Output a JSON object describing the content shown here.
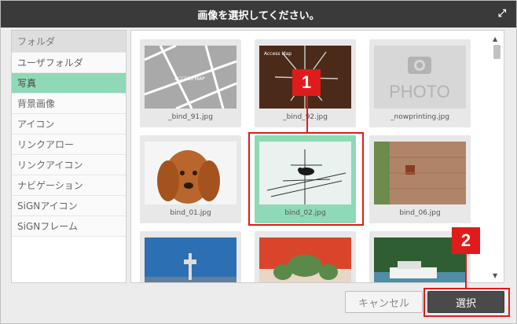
{
  "dialog": {
    "title": "画像を選択してください。",
    "expand_icon": "expand-icon"
  },
  "sidebar": {
    "items": [
      {
        "label": "フォルダ"
      },
      {
        "label": "ユーザフォルダ"
      },
      {
        "label": "写真"
      },
      {
        "label": "背景画像"
      },
      {
        "label": "アイコン"
      },
      {
        "label": "リンクアロー"
      },
      {
        "label": "リンクアイコン"
      },
      {
        "label": "ナビゲーション"
      },
      {
        "label": "SiGNアイコン"
      },
      {
        "label": "SiGNフレーム"
      }
    ],
    "selected_index": 2
  },
  "thumbnails": [
    {
      "filename": "_bind_91.jpg",
      "kind": "access-map",
      "text": "ACCESS MAP"
    },
    {
      "filename": "_bind_92.jpg",
      "kind": "access-map-dark",
      "text": "Access Map"
    },
    {
      "filename": "_nowprinting.jpg",
      "kind": "photo-placeholder",
      "text": "PHOTO"
    },
    {
      "filename": "bind_01.jpg",
      "kind": "dog"
    },
    {
      "filename": "bind_02.jpg",
      "kind": "bird",
      "selected": true
    },
    {
      "filename": "bind_06.jpg",
      "kind": "wall"
    },
    {
      "filename": "",
      "kind": "tower"
    },
    {
      "filename": "",
      "kind": "plants"
    },
    {
      "filename": "",
      "kind": "boat"
    }
  ],
  "buttons": {
    "cancel": "キャンセル",
    "select": "選択"
  },
  "callouts": {
    "one": "1",
    "two": "2"
  },
  "colors": {
    "titlebar": "#3a3a3a",
    "selected": "#8fd9b6",
    "callout": "#e01b1b"
  }
}
